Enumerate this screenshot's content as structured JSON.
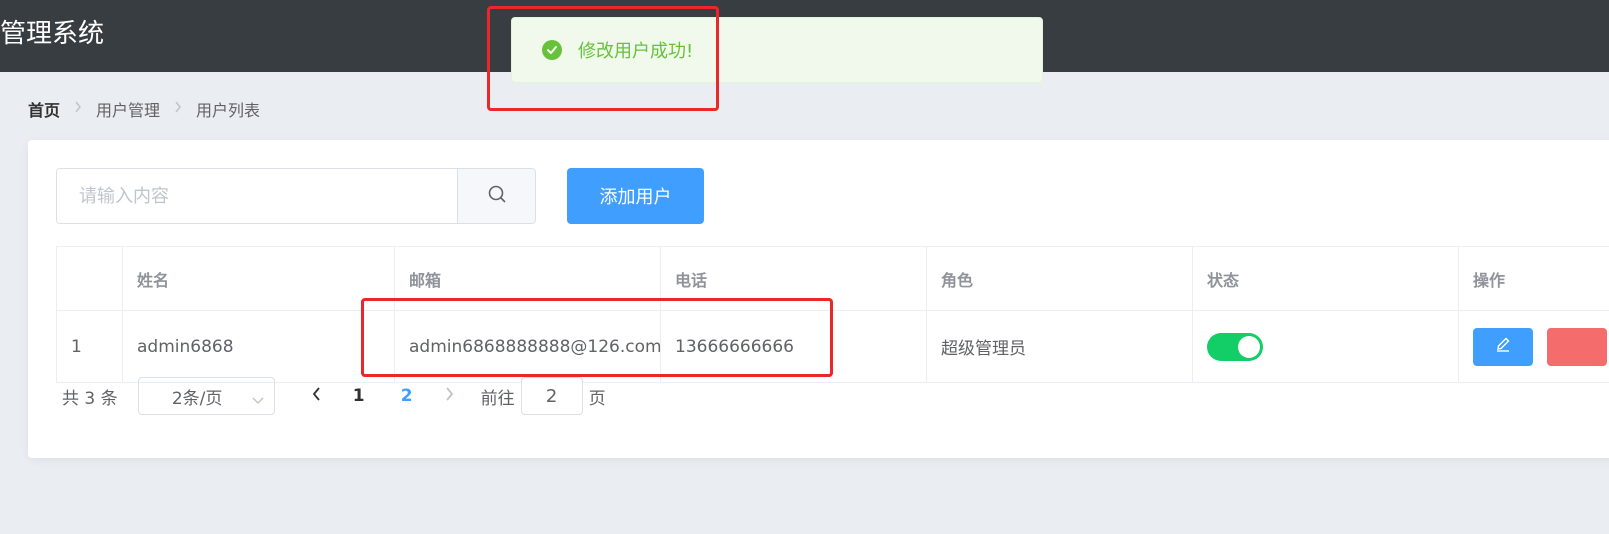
{
  "header": {
    "title": "管理系统"
  },
  "toast": {
    "message": "修改用户成功!",
    "type": "success",
    "color": "#67c23a"
  },
  "breadcrumb": {
    "items": [
      "首页",
      "用户管理",
      "用户列表"
    ]
  },
  "toolbar": {
    "search_placeholder": "请输入内容",
    "search_value": "",
    "add_button_label": "添加用户"
  },
  "table": {
    "columns": [
      "",
      "姓名",
      "邮箱",
      "电话",
      "角色",
      "状态",
      "操作"
    ],
    "rows": [
      {
        "index": "1",
        "name": "admin6868",
        "email": "admin6868888888@126.com",
        "phone": "13666666666",
        "role": "超级管理员",
        "status_on": true
      }
    ]
  },
  "pagination": {
    "total_label": "共 3 条",
    "page_size_label": "2条/页",
    "pages": [
      "1",
      "2"
    ],
    "current_page": "2",
    "jumper_label": "前往",
    "jumper_value": "2",
    "jumper_suffix": "页"
  },
  "colors": {
    "primary": "#409eff",
    "success": "#67c23a",
    "danger": "#f56c6c",
    "switch_on": "#13ce66",
    "header_bg": "#373d41",
    "annotation": "#e8282b"
  }
}
